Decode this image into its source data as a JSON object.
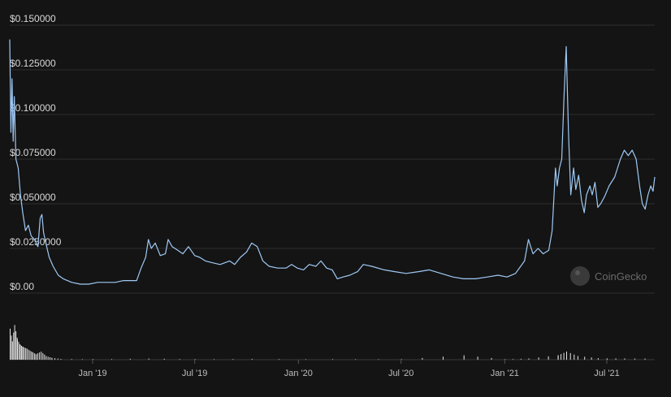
{
  "chart_data": {
    "type": "line",
    "title": "",
    "xlabel": "",
    "ylabel": "",
    "ylim": [
      0,
      0.15
    ],
    "grid": true,
    "y_ticks": [
      {
        "value": 0.15,
        "label": "$0.150000"
      },
      {
        "value": 0.125,
        "label": "$0.125000"
      },
      {
        "value": 0.1,
        "label": "$0.100000"
      },
      {
        "value": 0.075,
        "label": "$0.075000"
      },
      {
        "value": 0.05,
        "label": "$0.050000"
      },
      {
        "value": 0.025,
        "label": "$0.0250000"
      },
      {
        "value": 0.0,
        "label": "$0.00"
      }
    ],
    "x_ticks": [
      {
        "date": "2019-01-01",
        "label": "Jan '19"
      },
      {
        "date": "2019-07-01",
        "label": "Jul '19"
      },
      {
        "date": "2020-01-01",
        "label": "Jan '20"
      },
      {
        "date": "2020-07-01",
        "label": "Jul '20"
      },
      {
        "date": "2021-01-01",
        "label": "Jan '21"
      },
      {
        "date": "2021-07-01",
        "label": "Jul '21"
      }
    ],
    "xlim": [
      "2018-08-07",
      "2021-09-24"
    ],
    "series": [
      {
        "color": "#9fc9f5",
        "points": [
          [
            "2018-08-07",
            0.142
          ],
          [
            "2018-08-09",
            0.09
          ],
          [
            "2018-08-11",
            0.12
          ],
          [
            "2018-08-13",
            0.085
          ],
          [
            "2018-08-15",
            0.11
          ],
          [
            "2018-08-18",
            0.075
          ],
          [
            "2018-08-22",
            0.07
          ],
          [
            "2018-08-26",
            0.055
          ],
          [
            "2018-08-30",
            0.045
          ],
          [
            "2018-09-04",
            0.035
          ],
          [
            "2018-09-09",
            0.038
          ],
          [
            "2018-09-14",
            0.032
          ],
          [
            "2018-09-20",
            0.03
          ],
          [
            "2018-09-26",
            0.026
          ],
          [
            "2018-09-30",
            0.042
          ],
          [
            "2018-10-03",
            0.044
          ],
          [
            "2018-10-06",
            0.034
          ],
          [
            "2018-10-10",
            0.028
          ],
          [
            "2018-10-16",
            0.02
          ],
          [
            "2018-10-23",
            0.015
          ],
          [
            "2018-11-01",
            0.01
          ],
          [
            "2018-11-10",
            0.008
          ],
          [
            "2018-11-25",
            0.006
          ],
          [
            "2018-12-10",
            0.005
          ],
          [
            "2018-12-25",
            0.005
          ],
          [
            "2019-01-10",
            0.006
          ],
          [
            "2019-01-25",
            0.006
          ],
          [
            "2019-02-10",
            0.006
          ],
          [
            "2019-02-25",
            0.007
          ],
          [
            "2019-03-10",
            0.007
          ],
          [
            "2019-03-20",
            0.007
          ],
          [
            "2019-03-28",
            0.014
          ],
          [
            "2019-04-05",
            0.02
          ],
          [
            "2019-04-10",
            0.03
          ],
          [
            "2019-04-15",
            0.025
          ],
          [
            "2019-04-22",
            0.028
          ],
          [
            "2019-05-01",
            0.021
          ],
          [
            "2019-05-10",
            0.022
          ],
          [
            "2019-05-15",
            0.03
          ],
          [
            "2019-05-22",
            0.026
          ],
          [
            "2019-06-01",
            0.024
          ],
          [
            "2019-06-10",
            0.022
          ],
          [
            "2019-06-20",
            0.026
          ],
          [
            "2019-07-01",
            0.021
          ],
          [
            "2019-07-10",
            0.02
          ],
          [
            "2019-07-20",
            0.018
          ],
          [
            "2019-08-01",
            0.017
          ],
          [
            "2019-08-15",
            0.016
          ],
          [
            "2019-09-01",
            0.018
          ],
          [
            "2019-09-10",
            0.016
          ],
          [
            "2019-09-20",
            0.02
          ],
          [
            "2019-10-01",
            0.023
          ],
          [
            "2019-10-10",
            0.028
          ],
          [
            "2019-10-20",
            0.026
          ],
          [
            "2019-10-30",
            0.018
          ],
          [
            "2019-11-10",
            0.015
          ],
          [
            "2019-11-25",
            0.014
          ],
          [
            "2019-12-10",
            0.014
          ],
          [
            "2019-12-20",
            0.016
          ],
          [
            "2019-12-30",
            0.014
          ],
          [
            "2020-01-10",
            0.013
          ],
          [
            "2020-01-20",
            0.016
          ],
          [
            "2020-02-01",
            0.015
          ],
          [
            "2020-02-10",
            0.018
          ],
          [
            "2020-02-20",
            0.014
          ],
          [
            "2020-03-01",
            0.013
          ],
          [
            "2020-03-10",
            0.008
          ],
          [
            "2020-03-20",
            0.009
          ],
          [
            "2020-04-01",
            0.01
          ],
          [
            "2020-04-15",
            0.012
          ],
          [
            "2020-04-25",
            0.016
          ],
          [
            "2020-05-10",
            0.015
          ],
          [
            "2020-06-01",
            0.013
          ],
          [
            "2020-06-20",
            0.012
          ],
          [
            "2020-07-10",
            0.011
          ],
          [
            "2020-08-01",
            0.012
          ],
          [
            "2020-08-20",
            0.013
          ],
          [
            "2020-09-10",
            0.011
          ],
          [
            "2020-10-01",
            0.009
          ],
          [
            "2020-10-20",
            0.008
          ],
          [
            "2020-11-10",
            0.008
          ],
          [
            "2020-12-01",
            0.009
          ],
          [
            "2020-12-20",
            0.01
          ],
          [
            "2021-01-05",
            0.009
          ],
          [
            "2021-01-20",
            0.011
          ],
          [
            "2021-02-05",
            0.018
          ],
          [
            "2021-02-12",
            0.03
          ],
          [
            "2021-02-20",
            0.022
          ],
          [
            "2021-03-01",
            0.025
          ],
          [
            "2021-03-10",
            0.022
          ],
          [
            "2021-03-20",
            0.024
          ],
          [
            "2021-03-26",
            0.035
          ],
          [
            "2021-04-01",
            0.07
          ],
          [
            "2021-04-04",
            0.06
          ],
          [
            "2021-04-08",
            0.07
          ],
          [
            "2021-04-12",
            0.075
          ],
          [
            "2021-04-16",
            0.11
          ],
          [
            "2021-04-20",
            0.138
          ],
          [
            "2021-04-24",
            0.09
          ],
          [
            "2021-04-28",
            0.055
          ],
          [
            "2021-05-03",
            0.07
          ],
          [
            "2021-05-07",
            0.058
          ],
          [
            "2021-05-12",
            0.066
          ],
          [
            "2021-05-17",
            0.052
          ],
          [
            "2021-05-22",
            0.045
          ],
          [
            "2021-05-26",
            0.055
          ],
          [
            "2021-06-01",
            0.06
          ],
          [
            "2021-06-05",
            0.055
          ],
          [
            "2021-06-10",
            0.062
          ],
          [
            "2021-06-15",
            0.048
          ],
          [
            "2021-06-20",
            0.05
          ],
          [
            "2021-06-27",
            0.054
          ],
          [
            "2021-07-05",
            0.06
          ],
          [
            "2021-07-15",
            0.065
          ],
          [
            "2021-07-25",
            0.075
          ],
          [
            "2021-08-01",
            0.08
          ],
          [
            "2021-08-08",
            0.077
          ],
          [
            "2021-08-15",
            0.08
          ],
          [
            "2021-08-22",
            0.075
          ],
          [
            "2021-08-28",
            0.06
          ],
          [
            "2021-09-02",
            0.05
          ],
          [
            "2021-09-07",
            0.047
          ],
          [
            "2021-09-12",
            0.055
          ],
          [
            "2021-09-17",
            0.06
          ],
          [
            "2021-09-21",
            0.057
          ],
          [
            "2021-09-24",
            0.065
          ]
        ]
      }
    ],
    "volume": {
      "color": "#e6e6e6",
      "scale_max": 1,
      "points": [
        [
          "2018-08-07",
          0.85
        ],
        [
          "2018-08-11",
          0.5
        ],
        [
          "2018-08-15",
          0.95
        ],
        [
          "2018-08-20",
          0.55
        ],
        [
          "2018-08-25",
          0.4
        ],
        [
          "2018-08-30",
          0.35
        ],
        [
          "2018-09-06",
          0.3
        ],
        [
          "2018-09-14",
          0.22
        ],
        [
          "2018-09-22",
          0.15
        ],
        [
          "2018-10-01",
          0.22
        ],
        [
          "2018-10-10",
          0.1
        ],
        [
          "2018-10-20",
          0.05
        ],
        [
          "2018-11-05",
          0.02
        ],
        [
          "2019-01-01",
          0.01
        ],
        [
          "2019-04-10",
          0.03
        ],
        [
          "2019-07-01",
          0.01
        ],
        [
          "2019-10-10",
          0.02
        ],
        [
          "2020-03-01",
          0.01
        ],
        [
          "2020-07-01",
          0.01
        ],
        [
          "2020-10-20",
          0.12
        ],
        [
          "2021-01-01",
          0.01
        ],
        [
          "2021-02-12",
          0.03
        ],
        [
          "2021-04-05",
          0.12
        ],
        [
          "2021-04-20",
          0.22
        ],
        [
          "2021-05-10",
          0.1
        ],
        [
          "2021-06-15",
          0.04
        ],
        [
          "2021-08-01",
          0.03
        ],
        [
          "2021-09-24",
          0.03
        ]
      ]
    },
    "watermark": "CoinGecko"
  }
}
